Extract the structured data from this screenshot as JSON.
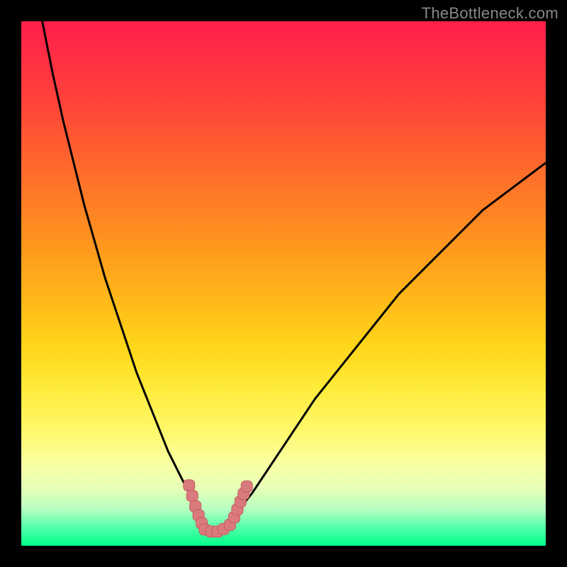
{
  "watermark": "TheBottleneck.com",
  "colors": {
    "curve_stroke": "#000000",
    "marker_fill": "#d97b7e",
    "marker_stroke": "#c85a5e"
  },
  "chart_data": {
    "type": "line",
    "title": "",
    "xlabel": "",
    "ylabel": "",
    "xlim": [
      0,
      100
    ],
    "ylim": [
      0,
      100
    ],
    "grid": false,
    "legend": false,
    "series": [
      {
        "name": "bottleneck-curve",
        "x": [
          4,
          6,
          8,
          10,
          12,
          14,
          16,
          18,
          20,
          22,
          24,
          26,
          28,
          30,
          32,
          34,
          35,
          36,
          38,
          40,
          44,
          48,
          52,
          56,
          60,
          64,
          68,
          72,
          76,
          80,
          84,
          88,
          92,
          96,
          100
        ],
        "y": [
          100,
          90,
          81,
          73,
          65,
          58,
          51,
          45,
          39,
          33,
          28,
          23,
          18,
          14,
          10,
          6,
          4,
          3,
          3,
          5,
          10,
          16,
          22,
          28,
          33,
          38,
          43,
          48,
          52,
          56,
          60,
          64,
          67,
          70,
          73
        ]
      }
    ],
    "markers": [
      {
        "name": "descending-cluster",
        "points": [
          {
            "x": 32.0,
            "y": 11.5
          },
          {
            "x": 32.6,
            "y": 9.5
          },
          {
            "x": 33.2,
            "y": 7.5
          },
          {
            "x": 33.8,
            "y": 5.8
          },
          {
            "x": 34.4,
            "y": 4.3
          }
        ]
      },
      {
        "name": "floor-cluster",
        "points": [
          {
            "x": 35.0,
            "y": 3.1
          },
          {
            "x": 36.2,
            "y": 2.7
          },
          {
            "x": 37.4,
            "y": 2.7
          },
          {
            "x": 38.6,
            "y": 3.2
          },
          {
            "x": 39.8,
            "y": 4.0
          }
        ]
      },
      {
        "name": "ascending-cluster",
        "points": [
          {
            "x": 40.6,
            "y": 5.4
          },
          {
            "x": 41.2,
            "y": 6.9
          },
          {
            "x": 41.8,
            "y": 8.4
          },
          {
            "x": 42.4,
            "y": 9.9
          },
          {
            "x": 43.0,
            "y": 11.3
          }
        ]
      }
    ]
  }
}
